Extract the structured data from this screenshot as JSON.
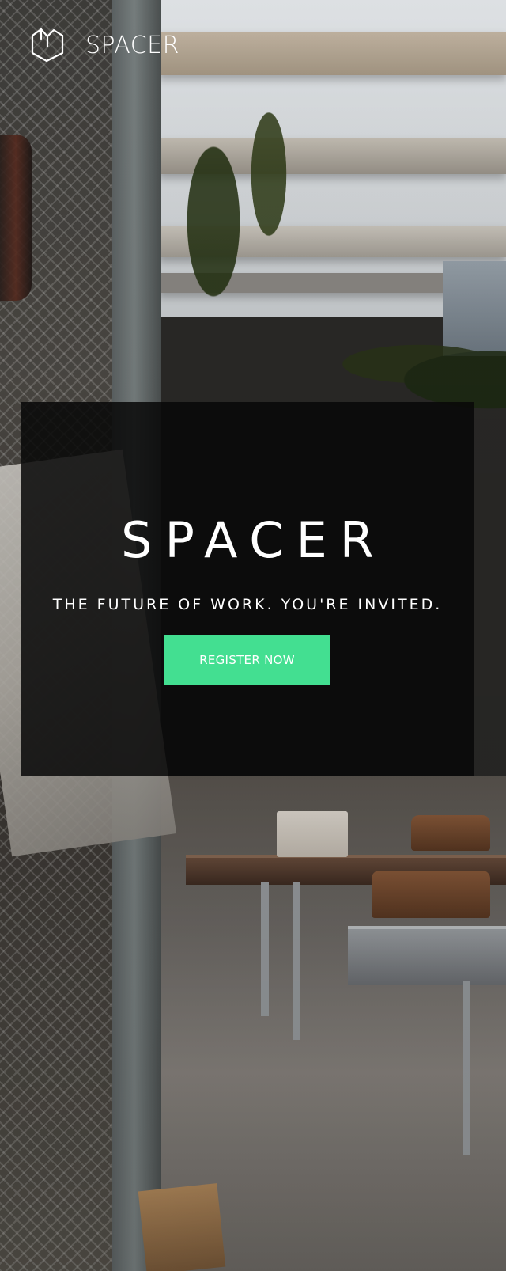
{
  "header": {
    "brand": "SPACER",
    "logo_icon": "m-cube-logo-icon"
  },
  "hero": {
    "title": "SPACER",
    "tagline": "THE FUTURE OF WORK. YOU'RE INVITED.",
    "cta_label": "REGISTER NOW"
  },
  "colors": {
    "accent": "#43df91",
    "overlay": "#080808",
    "text": "#ffffff"
  }
}
